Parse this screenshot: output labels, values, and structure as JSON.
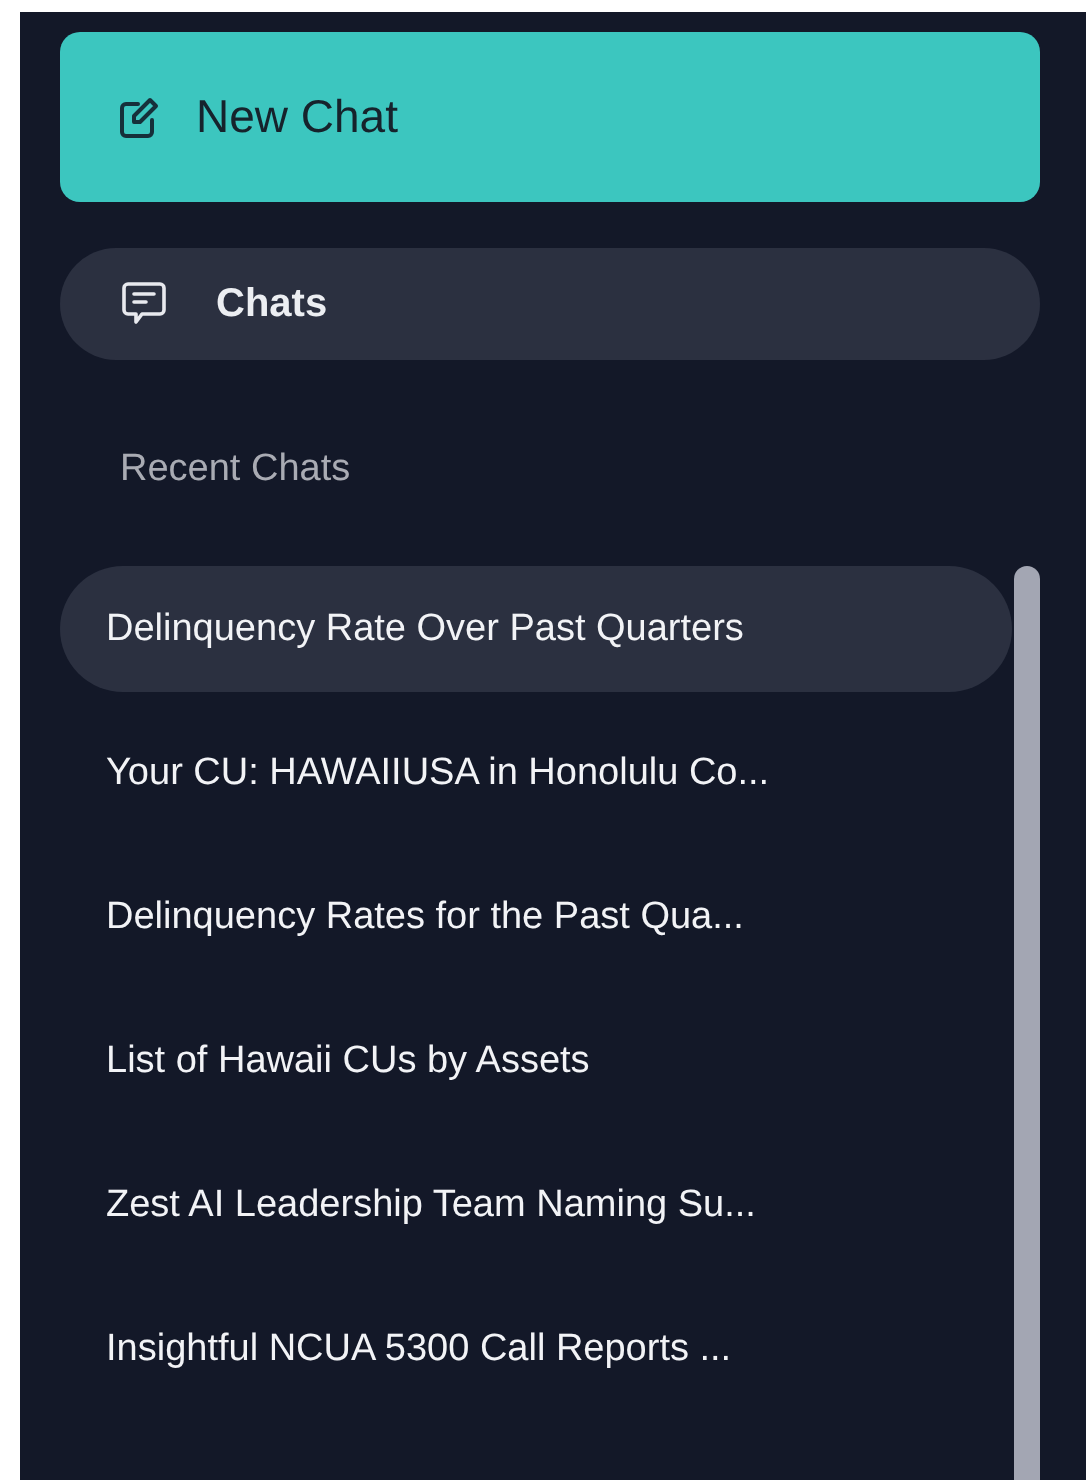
{
  "new_chat_button": {
    "label": "New Chat"
  },
  "nav": [
    {
      "label": "Chats",
      "selected": true
    }
  ],
  "recent_heading": "Recent Chats",
  "recent_chats": [
    {
      "title": "Delinquency Rate Over Past Quarters",
      "selected": true
    },
    {
      "title": "Your CU: HAWAIIUSA in Honolulu Co...",
      "selected": false
    },
    {
      "title": "Delinquency Rates for the Past Qua...",
      "selected": false
    },
    {
      "title": "List of Hawaii CUs by Assets",
      "selected": false
    },
    {
      "title": "Zest AI Leadership Team Naming Su...",
      "selected": false
    },
    {
      "title": "Insightful NCUA 5300 Call Reports ...",
      "selected": false
    }
  ]
}
